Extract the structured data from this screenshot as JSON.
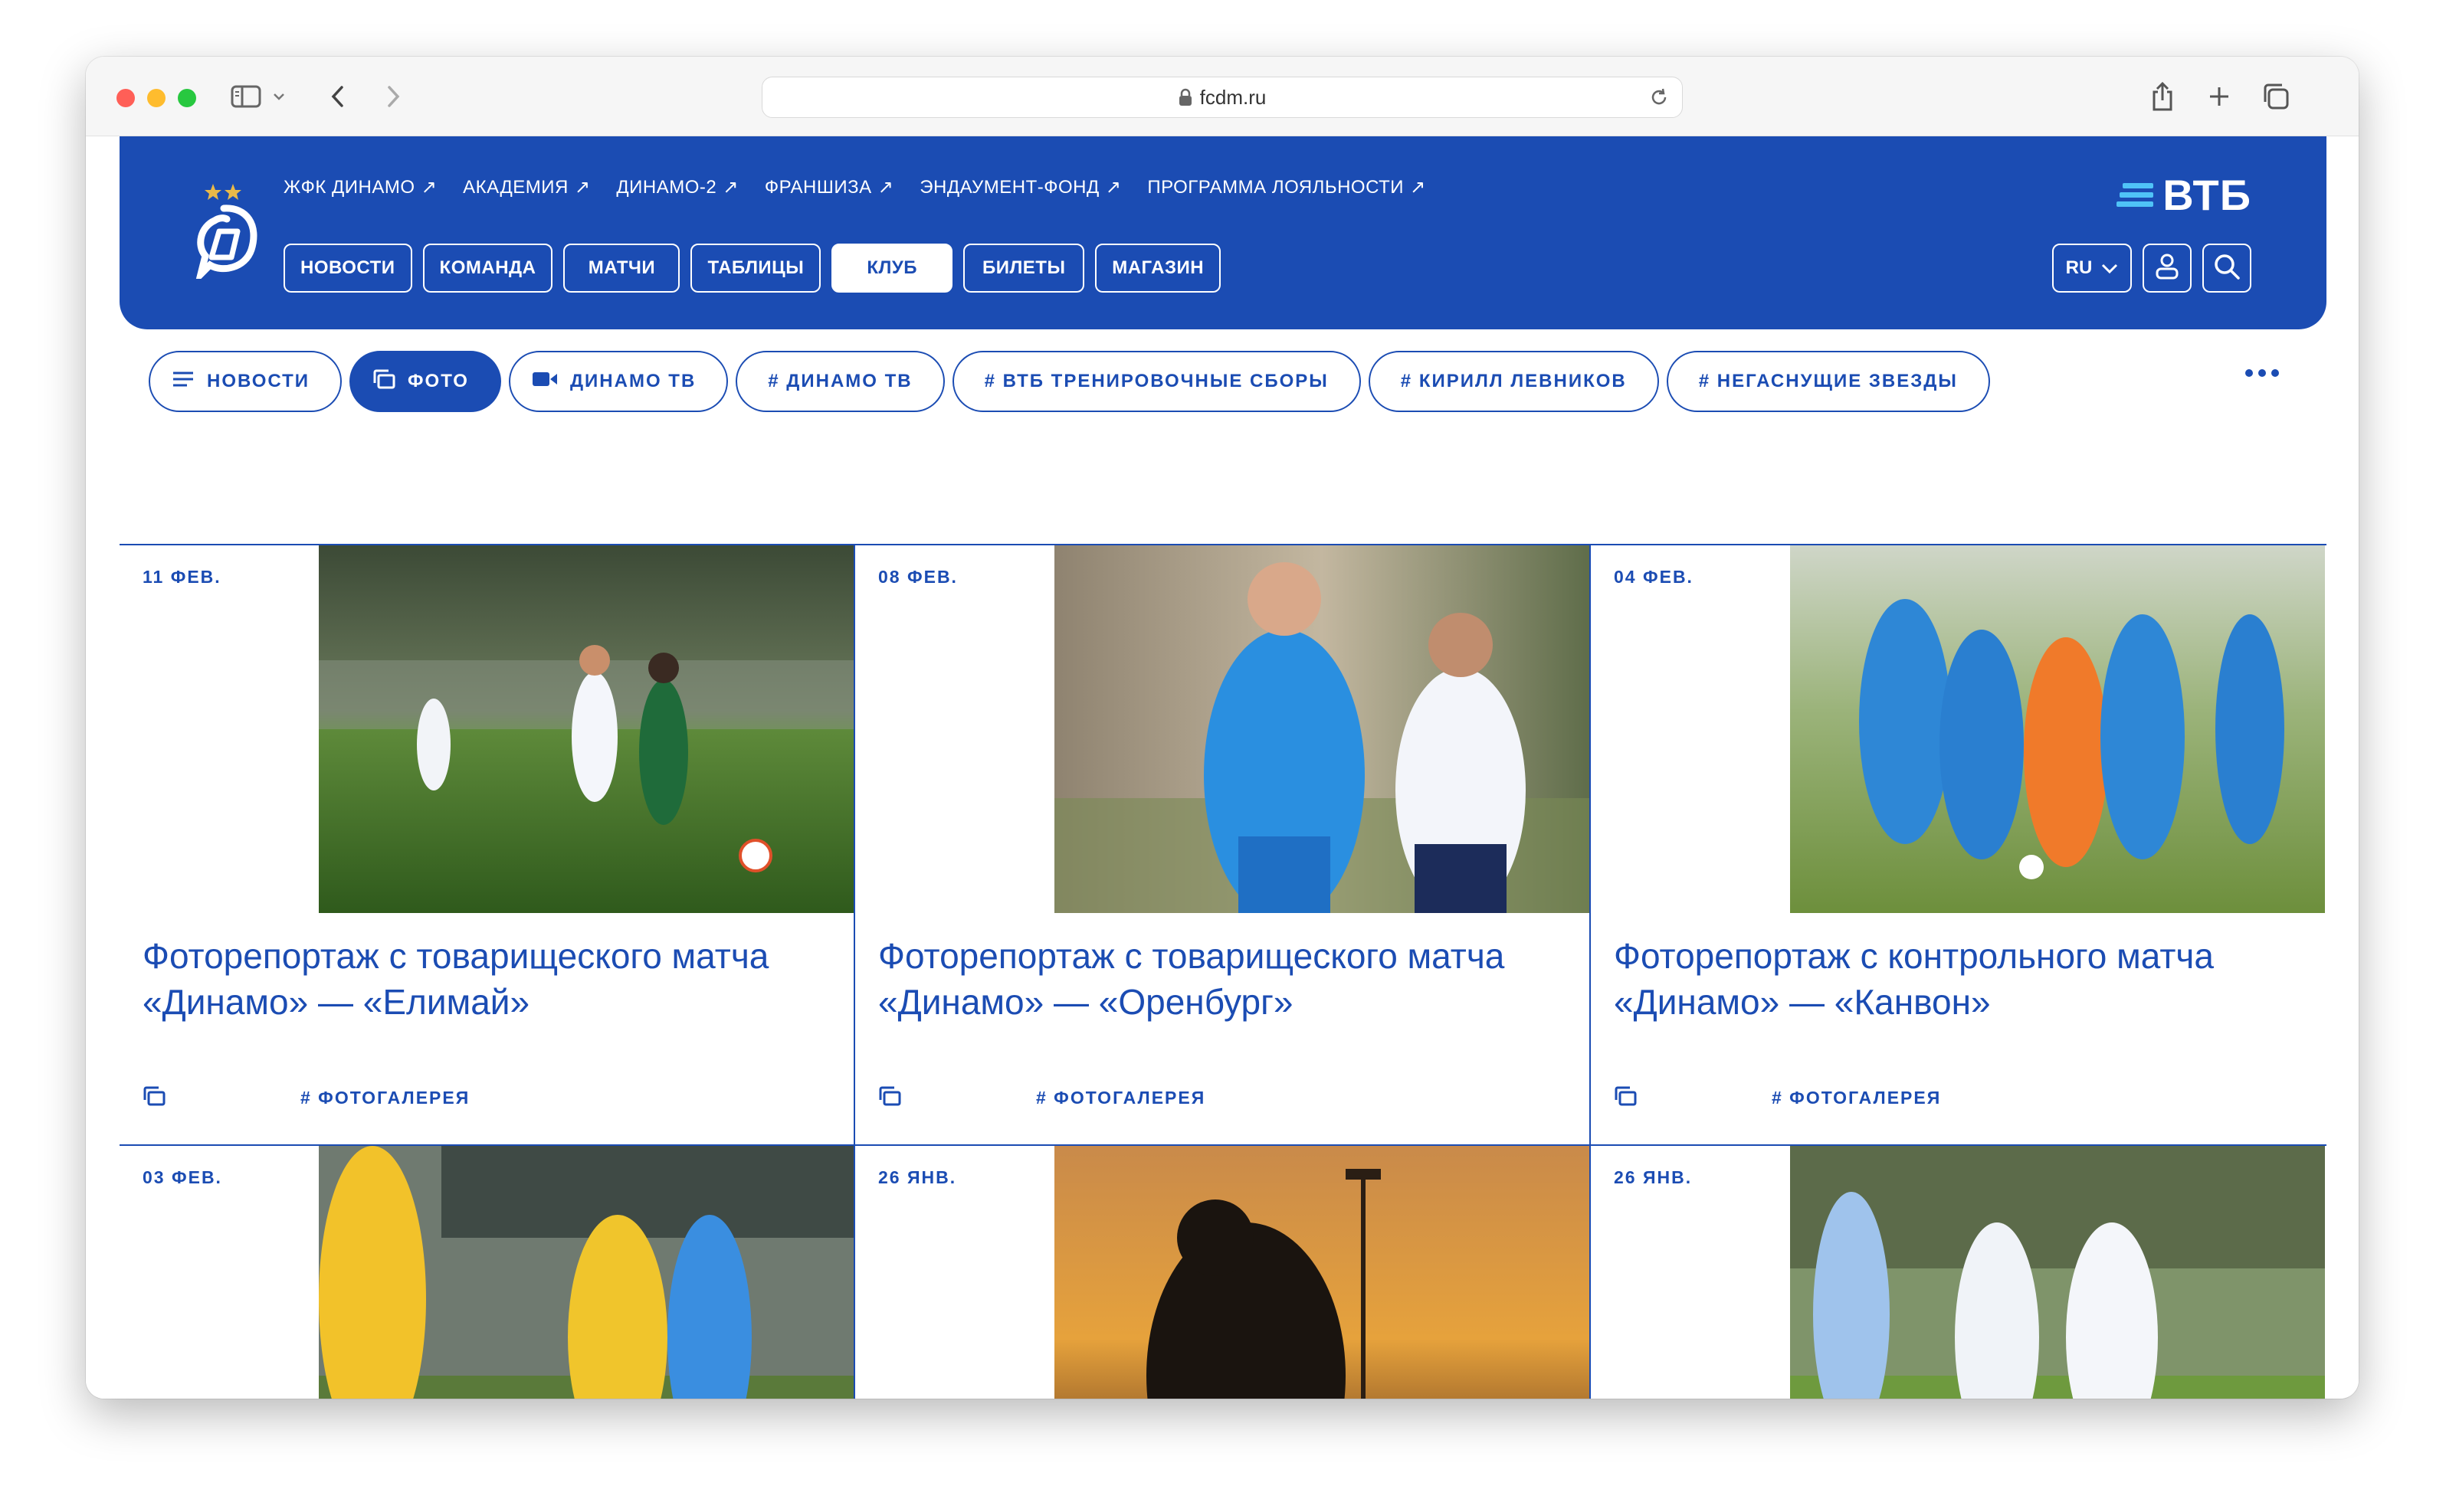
{
  "browser": {
    "url": "fcdm.ru"
  },
  "header": {
    "top_links": [
      "ЖФК ДИНАМО",
      "АКАДЕМИЯ",
      "ДИНАМО-2",
      "ФРАНШИЗА",
      "ЭНДАУМЕНТ-ФОНД",
      "ПРОГРАММА ЛОЯЛЬНОСТИ"
    ],
    "nav": [
      "НОВОСТИ",
      "КОМАНДА",
      "МАТЧИ",
      "ТАБЛИЦЫ",
      "КЛУБ",
      "БИЛЕТЫ",
      "МАГАЗИН"
    ],
    "active_nav": "КЛУБ",
    "sponsor": "ВТБ",
    "lang": "RU"
  },
  "filters": {
    "items": [
      "НОВОСТИ",
      "ФОТО",
      "ДИНАМО ТВ",
      "# ДИНАМО ТВ",
      "# ВТБ ТРЕНИРОВОЧНЫЕ СБОРЫ",
      "# КИРИЛЛ ЛЕВНИКОВ",
      "# НЕГАСНУЩИЕ ЗВЕЗДЫ"
    ],
    "active": "ФОТО"
  },
  "cards": [
    {
      "date": "11 ФЕВ.",
      "title": "Фоторепортаж с товарищеского матча «Динамо» — «Елимай»",
      "tag": "# ФОТОГАЛЕРЕЯ"
    },
    {
      "date": "08 ФЕВ.",
      "title": "Фоторепортаж с товарищеского матча «Динамо» — «Оренбург»",
      "tag": "# ФОТОГАЛЕРЕЯ"
    },
    {
      "date": "04 ФЕВ.",
      "title": "Фоторепортаж с контрольного матча «Динамо» — «Канвон»",
      "tag": "# ФОТОГАЛЕРЕЯ"
    },
    {
      "date": "03 ФЕВ."
    },
    {
      "date": "26 ЯНВ."
    },
    {
      "date": "26 ЯНВ."
    }
  ],
  "colors": {
    "brand": "#1b4cb3",
    "accent_light": "#4fc3f7"
  }
}
